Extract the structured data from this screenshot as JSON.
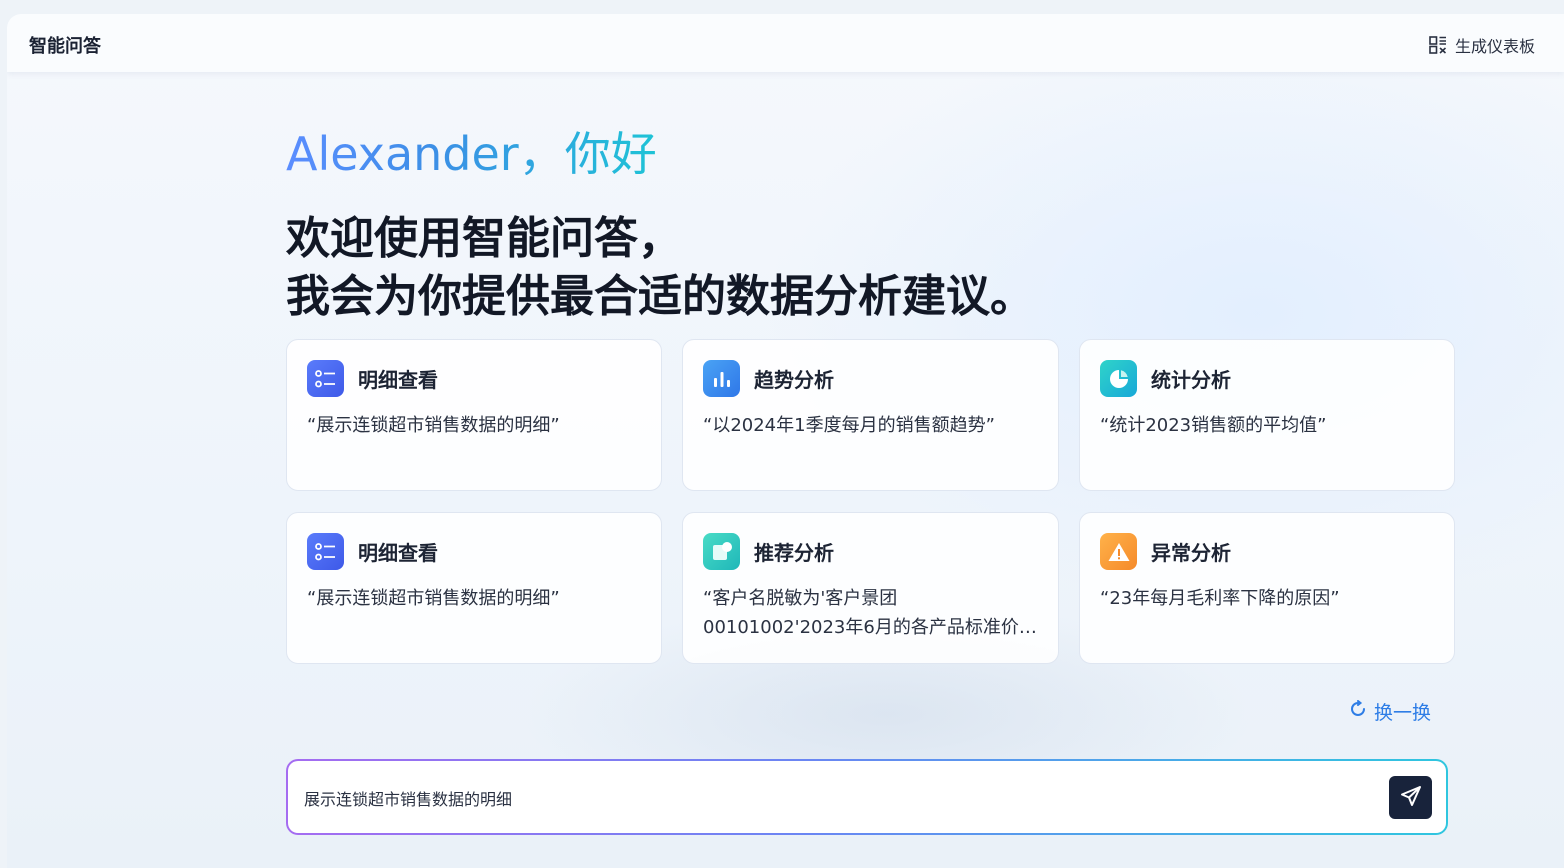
{
  "header": {
    "title": "智能问答",
    "dashboard_label": "生成仪表板",
    "dashboard_icon": "dashboard-grid-icon"
  },
  "hero": {
    "greeting": "Alexander，你好",
    "welcome_line1": "欢迎使用智能问答，",
    "welcome_line2": "我会为你提供最合适的数据分析建议。"
  },
  "cards": [
    {
      "title": "明细查看",
      "text": "“展示连锁超市销售数据的明细”",
      "icon": "list-detail-icon",
      "color": "#4a6cf7"
    },
    {
      "title": "趋势分析",
      "text": "“以2024年1季度每月的销售额趋势”",
      "icon": "bar-chart-icon",
      "color": "#3d8bef"
    },
    {
      "title": "统计分析",
      "text": "“统计2023销售额的平均值”",
      "icon": "pie-chart-icon",
      "color": "#1cc2cf"
    },
    {
      "title": "明细查看",
      "text": "“展示连锁超市销售数据的明细”",
      "icon": "list-detail-icon",
      "color": "#4a6cf7"
    },
    {
      "title": "推荐分析",
      "text": "“客户名脱敏为'客户景团00101002'2023年6月的各产品标准价格”",
      "icon": "recommend-icon",
      "color": "#2ec9c0"
    },
    {
      "title": "异常分析",
      "text": "“23年每月毛利率下降的原因”",
      "icon": "warning-icon",
      "color": "#f7a03a"
    }
  ],
  "refresh": {
    "label": "换一换",
    "icon": "refresh-icon"
  },
  "input": {
    "value": "展示连锁超市销售数据的明细",
    "send_icon": "send-icon"
  },
  "colors": {
    "accent_blue": "#2e7de6",
    "send_button": "#18233b",
    "input_gradient": [
      "#a56cf1",
      "#6a86f3",
      "#2fc6df"
    ]
  }
}
